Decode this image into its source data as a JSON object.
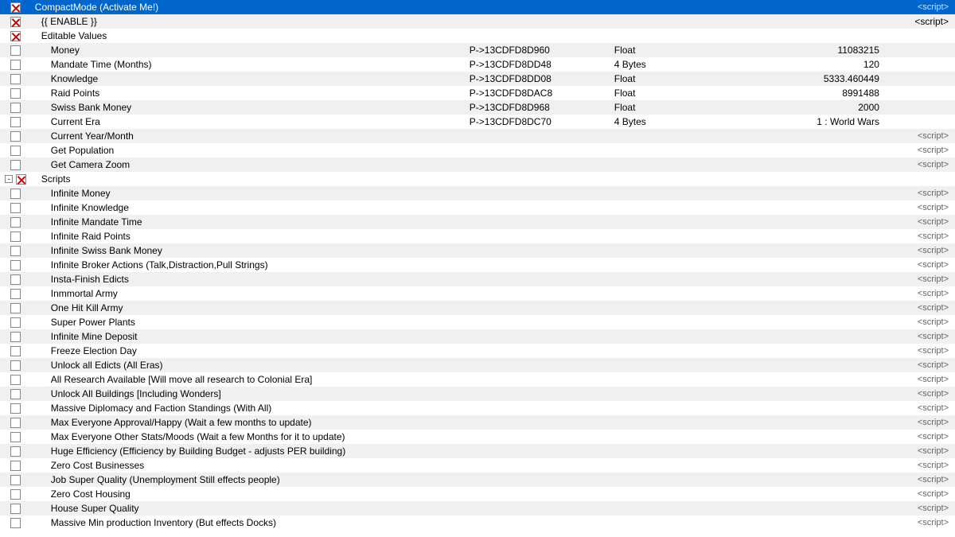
{
  "rows": [
    {
      "type": "compact",
      "checkbox": "checked",
      "name": "CompactMode (Activate  Me!)",
      "pointer": "",
      "datatype": "",
      "spacer": "",
      "value": "",
      "script": "<script>"
    },
    {
      "type": "enable",
      "checkbox": "none",
      "name": "{{ ENABLE }}",
      "pointer": "",
      "datatype": "",
      "spacer": "",
      "value": "",
      "script": "<script>"
    },
    {
      "type": "editable_header",
      "checkbox": "none",
      "name": "Editable Values",
      "pointer": "",
      "datatype": "",
      "spacer": "",
      "value": "",
      "script": ""
    },
    {
      "type": "data",
      "checkbox": "empty",
      "name": "Money",
      "pointer": "P->13CDFD8D960",
      "datatype": "Float",
      "spacer": "",
      "value": "11083215",
      "script": ""
    },
    {
      "type": "data",
      "checkbox": "empty",
      "name": "Mandate Time (Months)",
      "pointer": "P->13CDFD8DD48",
      "datatype": "4 Bytes",
      "spacer": "",
      "value": "120",
      "script": ""
    },
    {
      "type": "data",
      "checkbox": "empty",
      "name": "Knowledge",
      "pointer": "P->13CDFD8DD08",
      "datatype": "Float",
      "spacer": "",
      "value": "5333.460449",
      "script": ""
    },
    {
      "type": "data",
      "checkbox": "empty",
      "name": "Raid Points",
      "pointer": "P->13CDFD8DAC8",
      "datatype": "Float",
      "spacer": "",
      "value": "8991488",
      "script": ""
    },
    {
      "type": "data",
      "checkbox": "empty",
      "name": "Swiss Bank Money",
      "pointer": "P->13CDFD8D968",
      "datatype": "Float",
      "spacer": "",
      "value": "2000",
      "script": ""
    },
    {
      "type": "data",
      "checkbox": "empty",
      "name": "Current Era",
      "pointer": "P->13CDFD8DC70",
      "datatype": "4 Bytes",
      "spacer": "",
      "value": "1 : World Wars",
      "script": ""
    },
    {
      "type": "script_item",
      "checkbox": "empty",
      "name": "Current Year/Month",
      "pointer": "",
      "datatype": "",
      "spacer": "",
      "value": "",
      "script": "<script>"
    },
    {
      "type": "script_item",
      "checkbox": "empty",
      "name": "Get Population",
      "pointer": "",
      "datatype": "",
      "spacer": "",
      "value": "",
      "script": "<script>"
    },
    {
      "type": "script_item",
      "checkbox": "empty",
      "name": "Get Camera Zoom",
      "pointer": "",
      "datatype": "",
      "spacer": "",
      "value": "",
      "script": "<script>"
    },
    {
      "type": "scripts_header",
      "checkbox": "collapse",
      "name": "Scripts",
      "pointer": "",
      "datatype": "",
      "spacer": "",
      "value": "",
      "script": ""
    },
    {
      "type": "script_item",
      "checkbox": "empty",
      "name": "Infinite Money",
      "pointer": "",
      "datatype": "",
      "spacer": "",
      "value": "",
      "script": "<script>"
    },
    {
      "type": "script_item",
      "checkbox": "empty",
      "name": "Infinite Knowledge",
      "pointer": "",
      "datatype": "",
      "spacer": "",
      "value": "",
      "script": "<script>"
    },
    {
      "type": "script_item",
      "checkbox": "empty",
      "name": "Infinite Mandate Time",
      "pointer": "",
      "datatype": "",
      "spacer": "",
      "value": "",
      "script": "<script>"
    },
    {
      "type": "script_item",
      "checkbox": "empty",
      "name": "Infinite Raid Points",
      "pointer": "",
      "datatype": "",
      "spacer": "",
      "value": "",
      "script": "<script>"
    },
    {
      "type": "script_item",
      "checkbox": "empty",
      "name": "Infinite Swiss Bank Money",
      "pointer": "",
      "datatype": "",
      "spacer": "",
      "value": "",
      "script": "<script>"
    },
    {
      "type": "script_item",
      "checkbox": "empty",
      "name": "Infinite Broker Actions (Talk,Distraction,Pull Strings)",
      "pointer": "",
      "datatype": "",
      "spacer": "",
      "value": "",
      "script": "<script>"
    },
    {
      "type": "script_item",
      "checkbox": "empty",
      "name": "Insta-Finish Edicts",
      "pointer": "",
      "datatype": "",
      "spacer": "",
      "value": "",
      "script": "<script>"
    },
    {
      "type": "script_item",
      "checkbox": "empty",
      "name": "Inmmortal Army",
      "pointer": "",
      "datatype": "",
      "spacer": "",
      "value": "",
      "script": "<script>"
    },
    {
      "type": "script_item",
      "checkbox": "empty",
      "name": "One Hit Kill Army",
      "pointer": "",
      "datatype": "",
      "spacer": "",
      "value": "",
      "script": "<script>"
    },
    {
      "type": "script_item",
      "checkbox": "empty",
      "name": "Super Power Plants",
      "pointer": "",
      "datatype": "",
      "spacer": "",
      "value": "",
      "script": "<script>"
    },
    {
      "type": "script_item",
      "checkbox": "empty",
      "name": "Infinite Mine Deposit",
      "pointer": "",
      "datatype": "",
      "spacer": "",
      "value": "",
      "script": "<script>"
    },
    {
      "type": "script_item",
      "checkbox": "empty",
      "name": "Freeze Election Day",
      "pointer": "",
      "datatype": "",
      "spacer": "",
      "value": "",
      "script": "<script>"
    },
    {
      "type": "script_item",
      "checkbox": "empty",
      "name": "Unlock all Edicts (All Eras)",
      "pointer": "",
      "datatype": "",
      "spacer": "",
      "value": "",
      "script": "<script>"
    },
    {
      "type": "script_item",
      "checkbox": "empty",
      "name": "All Research Available [Will move all research to Colonial Era]",
      "pointer": "",
      "datatype": "",
      "spacer": "",
      "value": "",
      "script": "<script>"
    },
    {
      "type": "script_item",
      "checkbox": "empty",
      "name": "Unlock All Buildings [Including Wonders]",
      "pointer": "",
      "datatype": "",
      "spacer": "",
      "value": "",
      "script": "<script>"
    },
    {
      "type": "script_item",
      "checkbox": "empty",
      "name": "Massive Diplomacy and Faction Standings (With All)",
      "pointer": "",
      "datatype": "",
      "spacer": "",
      "value": "",
      "script": "<script>"
    },
    {
      "type": "script_item",
      "checkbox": "empty",
      "name": "Max Everyone Approval/Happy (Wait a few months to update)",
      "pointer": "",
      "datatype": "",
      "spacer": "",
      "value": "",
      "script": "<script>"
    },
    {
      "type": "script_item",
      "checkbox": "empty",
      "name": "Max Everyone Other Stats/Moods (Wait a few Months for it to update)",
      "pointer": "",
      "datatype": "",
      "spacer": "",
      "value": "",
      "script": "<script>"
    },
    {
      "type": "script_item",
      "checkbox": "empty",
      "name": "Huge Efficiency (Efficiency by Building Budget - adjusts PER building)",
      "pointer": "",
      "datatype": "",
      "spacer": "",
      "value": "",
      "script": "<script>"
    },
    {
      "type": "script_item",
      "checkbox": "empty",
      "name": "Zero Cost Businesses",
      "pointer": "",
      "datatype": "",
      "spacer": "",
      "value": "",
      "script": "<script>"
    },
    {
      "type": "script_item",
      "checkbox": "empty",
      "name": "Job Super Quality (Unemployment Still effects people)",
      "pointer": "",
      "datatype": "",
      "spacer": "",
      "value": "",
      "script": "<script>"
    },
    {
      "type": "script_item",
      "checkbox": "empty",
      "name": "Zero Cost Housing",
      "pointer": "",
      "datatype": "",
      "spacer": "",
      "value": "",
      "script": "<script>"
    },
    {
      "type": "script_item",
      "checkbox": "empty",
      "name": "House Super Quality",
      "pointer": "",
      "datatype": "",
      "spacer": "",
      "value": "",
      "script": "<script>"
    },
    {
      "type": "script_item",
      "checkbox": "empty",
      "name": "Massive Min production Inventory (But effects Docks)",
      "pointer": "",
      "datatype": "",
      "spacer": "",
      "value": "",
      "script": "<script>"
    }
  ],
  "labels": {
    "script_tag": "<script>",
    "compact_script_tag": "<script>"
  }
}
